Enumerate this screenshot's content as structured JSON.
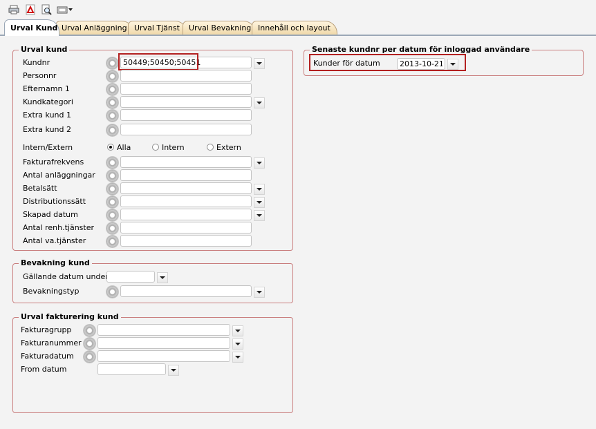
{
  "toolbar": {
    "icons": [
      "printer-icon",
      "pdf-icon",
      "print-preview-icon",
      "export-icon"
    ]
  },
  "tabs": [
    {
      "label": "Urval Kund",
      "active": true
    },
    {
      "label": "Urval Anläggning",
      "active": false
    },
    {
      "label": "Urval Tjänst",
      "active": false
    },
    {
      "label": "Urval Bevakning",
      "active": false
    },
    {
      "label": "Innehåll och layout",
      "active": false
    }
  ],
  "urval_kund": {
    "title": "Urval kund",
    "kundnr": {
      "label": "Kundnr",
      "value": "50449;50450;50451"
    },
    "personnr": {
      "label": "Personnr",
      "value": ""
    },
    "efternamn1": {
      "label": "Efternamn 1",
      "value": ""
    },
    "kundkategori": {
      "label": "Kundkategori",
      "value": ""
    },
    "extrakund1": {
      "label": "Extra kund 1",
      "value": ""
    },
    "extrakund2": {
      "label": "Extra kund 2",
      "value": ""
    },
    "intern_extern": {
      "label": "Intern/Extern",
      "options": [
        "Alla",
        "Intern",
        "Extern"
      ],
      "selected": "Alla"
    },
    "fakturafrekvens": {
      "label": "Fakturafrekvens",
      "value": ""
    },
    "antal_anlaggningar": {
      "label": "Antal anläggningar",
      "value": ""
    },
    "betalsatt": {
      "label": "Betalsätt",
      "value": ""
    },
    "distributionssatt": {
      "label": "Distributionssätt",
      "value": ""
    },
    "skapad_datum": {
      "label": "Skapad datum",
      "value": ""
    },
    "antal_renh": {
      "label": "Antal renh.tjänster",
      "value": ""
    },
    "antal_va": {
      "label": "Antal va.tjänster",
      "value": ""
    }
  },
  "bevakning_kund": {
    "title": "Bevakning kund",
    "gallande_datum": {
      "label": "Gällande datum under",
      "value": ""
    },
    "bevakningstyp": {
      "label": "Bevakningstyp",
      "value": ""
    }
  },
  "urval_fakturering": {
    "title": "Urval fakturering kund",
    "fakturagrupp": {
      "label": "Fakturagrupp",
      "value": ""
    },
    "fakturanummer": {
      "label": "Fakturanummer",
      "value": ""
    },
    "fakturadatum": {
      "label": "Fakturadatum",
      "value": ""
    },
    "from_datum": {
      "label": "From datum",
      "value": ""
    }
  },
  "senaste": {
    "title": "Senaste kundnr per datum för inloggad användare",
    "kunder_for_datum": {
      "label": "Kunder för datum",
      "value": "2013-10-21"
    }
  },
  "colors": {
    "group_border": "#c97d7d",
    "highlight": "#b32020",
    "tab_inactive": "#f0d9aa",
    "tab_line": "#9aa7b6"
  }
}
